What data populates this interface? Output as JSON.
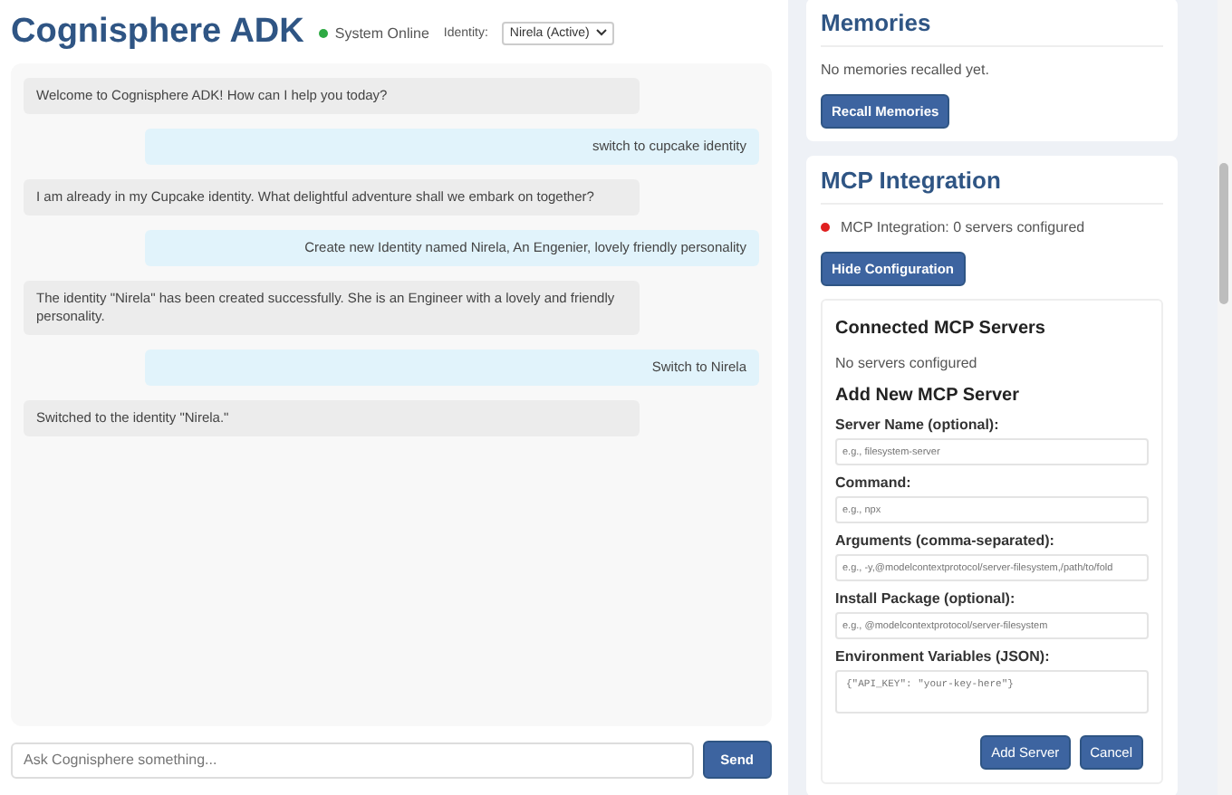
{
  "header": {
    "title": "Cognisphere ADK",
    "status": {
      "label": "System Online",
      "online": true
    },
    "identity": {
      "label": "Identity:",
      "value": "Nirela (Active)"
    }
  },
  "messages": [
    {
      "kind": "bot",
      "text": "Welcome to Cognisphere ADK! How can I help you today?"
    },
    {
      "kind": "user",
      "text": "switch to cupcake identity"
    },
    {
      "kind": "bot",
      "text": "I am already in my Cupcake identity. What delightful adventure shall we embark on together?"
    },
    {
      "kind": "user",
      "text": "Create new Identity named Nirela, An Engenier, lovely friendly personality"
    },
    {
      "kind": "bot",
      "text": "The identity \"Nirela\" has been created successfully. She is an Engineer with a lovely and friendly personality."
    },
    {
      "kind": "user",
      "text": "Switch to Nirela"
    },
    {
      "kind": "bot",
      "text": "Switched to the identity \"Nirela.\""
    }
  ],
  "input": {
    "placeholder": "Ask Cognisphere something...",
    "button": "Send"
  },
  "memories": {
    "title": "Memories",
    "empty_text": "No memories recalled yet.",
    "button": "Recall Memories"
  },
  "mcp": {
    "title": "MCP Integration",
    "status": {
      "text": "MCP Integration: 0 servers configured",
      "connected": false
    },
    "toggle_button": "Hide Configuration",
    "connected_title": "Connected MCP Servers",
    "connected_empty": "No servers configured",
    "form_title": "Add New MCP Server",
    "fields": [
      {
        "kind": "input",
        "label": "Server Name (optional):",
        "placeholder": "e.g., filesystem-server"
      },
      {
        "kind": "input",
        "label": "Command:",
        "placeholder": "e.g., npx"
      },
      {
        "kind": "input",
        "label": "Arguments (comma-separated):",
        "placeholder": "e.g., -y,@modelcontextprotocol/server-filesystem,/path/to/fold"
      },
      {
        "kind": "input",
        "label": "Install Package (optional):",
        "placeholder": "e.g., @modelcontextprotocol/server-filesystem"
      },
      {
        "kind": "textarea",
        "label": "Environment Variables (JSON):",
        "placeholder": "{\"API_KEY\": \"your-key-here\"}"
      }
    ],
    "buttons": [
      "Add Server",
      "Cancel"
    ]
  }
}
